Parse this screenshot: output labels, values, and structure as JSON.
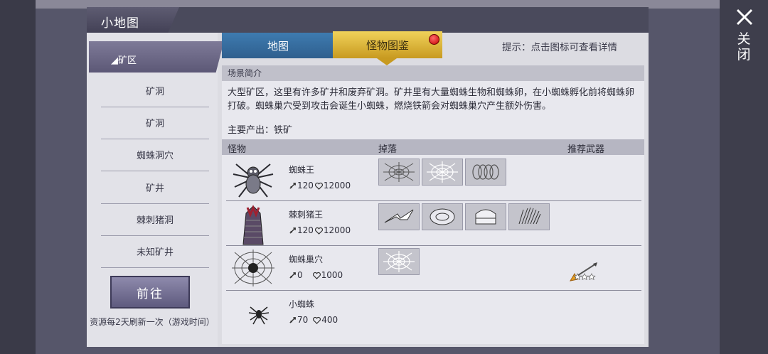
{
  "window": {
    "title": "小地图",
    "close_label": "关闭"
  },
  "sidebar": {
    "active": "◢矿区",
    "items": [
      "矿洞",
      "矿洞",
      "蜘蛛洞穴",
      "矿井",
      "棘刺猪洞",
      "未知矿井"
    ],
    "go_button": "前往",
    "note": "资源每2天刷新一次（游戏时间）"
  },
  "tabs": [
    {
      "label": "地图",
      "active": false
    },
    {
      "label": "怪物图鉴",
      "active": true
    }
  ],
  "hint": "提示：点击图标可查看详情",
  "scene": {
    "section_title": "场景简介",
    "description": "大型矿区，这里有许多矿井和废弃矿洞。矿井里有大量蜘蛛生物和蜘蛛卵，在小蜘蛛孵化前将蜘蛛卵打破。蜘蛛巢穴受到攻击会诞生小蜘蛛，燃烧铁箭会对蜘蛛巢穴产生额外伤害。",
    "output": "主要产出：铁矿"
  },
  "table": {
    "headers": {
      "monster": "怪物",
      "drops": "掉落",
      "weapon": "推荐武器"
    },
    "rows": [
      {
        "name": "蜘蛛王",
        "attack": "120",
        "hp": "12000",
        "icon": "spider-king-icon",
        "drops": [
          "spider-silk-icon",
          "cobweb-icon",
          "coiled-thread-icon"
        ]
      },
      {
        "name": "棘刺猪王",
        "attack": "120",
        "hp": "12000",
        "icon": "boar-king-icon",
        "drops": [
          "tusk-icon",
          "meat-icon",
          "fat-icon",
          "bristle-icon"
        ]
      },
      {
        "name": "蜘蛛巢穴",
        "attack": "0",
        "hp": "1000",
        "icon": "spider-nest-icon",
        "drops": [
          "cobweb-icon"
        ],
        "weapon": "burning-arrow-icon",
        "weapon_stars": 1
      },
      {
        "name": "小蜘蛛",
        "attack": "70",
        "hp": "400",
        "icon": "small-spider-icon",
        "drops": []
      }
    ]
  },
  "colors": {
    "tab_active": "#e0b83a",
    "tab_inactive": "#3a70a2",
    "badge": "#d01010"
  }
}
